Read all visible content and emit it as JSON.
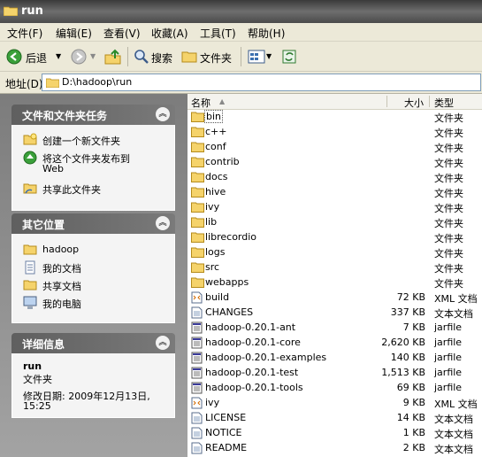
{
  "window": {
    "title": "run"
  },
  "menu": [
    {
      "label": "文件(F)"
    },
    {
      "label": "编辑(E)"
    },
    {
      "label": "查看(V)"
    },
    {
      "label": "收藏(A)"
    },
    {
      "label": "工具(T)"
    },
    {
      "label": "帮助(H)"
    }
  ],
  "toolbar": {
    "back": "后退",
    "search": "搜索",
    "folders": "文件夹"
  },
  "address": {
    "label": "地址(D)",
    "path": "D:\\hadoop\\run"
  },
  "tasks": {
    "title": "文件和文件夹任务",
    "items": [
      {
        "label": "创建一个新文件夹",
        "icon": "new-folder-icon"
      },
      {
        "label": "将这个文件夹发布到",
        "label2": "Web",
        "icon": "publish-web-icon"
      },
      {
        "label": "共享此文件夹",
        "icon": "share-folder-icon"
      }
    ]
  },
  "places": {
    "title": "其它位置",
    "items": [
      {
        "label": "hadoop",
        "icon": "folder-icon"
      },
      {
        "label": "我的文档",
        "icon": "my-documents-icon"
      },
      {
        "label": "共享文档",
        "icon": "folder-icon"
      },
      {
        "label": "我的电脑",
        "icon": "my-computer-icon"
      }
    ]
  },
  "details": {
    "title": "详细信息",
    "name": "run",
    "type": "文件夹",
    "modified": "修改日期: 2009年12月13日,",
    "modified2": "15:25"
  },
  "columns": {
    "name": "名称",
    "size": "大小",
    "type": "类型"
  },
  "files": [
    {
      "name": "bin",
      "size": "",
      "type": "文件夹",
      "kind": "folder"
    },
    {
      "name": "c++",
      "size": "",
      "type": "文件夹",
      "kind": "folder"
    },
    {
      "name": "conf",
      "size": "",
      "type": "文件夹",
      "kind": "folder"
    },
    {
      "name": "contrib",
      "size": "",
      "type": "文件夹",
      "kind": "folder"
    },
    {
      "name": "docs",
      "size": "",
      "type": "文件夹",
      "kind": "folder"
    },
    {
      "name": "hive",
      "size": "",
      "type": "文件夹",
      "kind": "folder"
    },
    {
      "name": "ivy",
      "size": "",
      "type": "文件夹",
      "kind": "folder"
    },
    {
      "name": "lib",
      "size": "",
      "type": "文件夹",
      "kind": "folder"
    },
    {
      "name": "librecordio",
      "size": "",
      "type": "文件夹",
      "kind": "folder"
    },
    {
      "name": "logs",
      "size": "",
      "type": "文件夹",
      "kind": "folder"
    },
    {
      "name": "src",
      "size": "",
      "type": "文件夹",
      "kind": "folder"
    },
    {
      "name": "webapps",
      "size": "",
      "type": "文件夹",
      "kind": "folder"
    },
    {
      "name": "build",
      "size": "72 KB",
      "type": "XML 文档",
      "kind": "xml"
    },
    {
      "name": "CHANGES",
      "size": "337 KB",
      "type": "文本文档",
      "kind": "text"
    },
    {
      "name": "hadoop-0.20.1-ant",
      "size": "7 KB",
      "type": "jarfile",
      "kind": "jar"
    },
    {
      "name": "hadoop-0.20.1-core",
      "size": "2,620 KB",
      "type": "jarfile",
      "kind": "jar"
    },
    {
      "name": "hadoop-0.20.1-examples",
      "size": "140 KB",
      "type": "jarfile",
      "kind": "jar"
    },
    {
      "name": "hadoop-0.20.1-test",
      "size": "1,513 KB",
      "type": "jarfile",
      "kind": "jar"
    },
    {
      "name": "hadoop-0.20.1-tools",
      "size": "69 KB",
      "type": "jarfile",
      "kind": "jar"
    },
    {
      "name": "ivy",
      "size": "9 KB",
      "type": "XML 文档",
      "kind": "xml"
    },
    {
      "name": "LICENSE",
      "size": "14 KB",
      "type": "文本文档",
      "kind": "text"
    },
    {
      "name": "NOTICE",
      "size": "1 KB",
      "type": "文本文档",
      "kind": "text"
    },
    {
      "name": "README",
      "size": "2 KB",
      "type": "文本文档",
      "kind": "text"
    }
  ],
  "colors": {
    "folder": "#f2c94c",
    "title_bg": "#4a4a4a",
    "panel_header": "#6b6b6b"
  }
}
